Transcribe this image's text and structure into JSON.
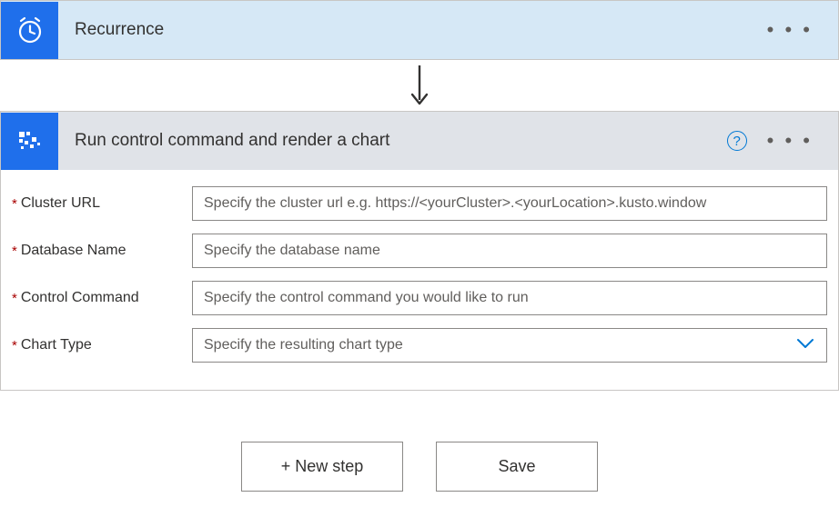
{
  "steps": {
    "recurrence": {
      "title": "Recurrence"
    },
    "kusto": {
      "title": "Run control command and render a chart",
      "fields": {
        "clusterUrl": {
          "label": "Cluster URL",
          "placeholder": "Specify the cluster url e.g. https://<yourCluster>.<yourLocation>.kusto.window"
        },
        "databaseName": {
          "label": "Database Name",
          "placeholder": "Specify the database name"
        },
        "controlCommand": {
          "label": "Control Command",
          "placeholder": "Specify the control command you would like to run"
        },
        "chartType": {
          "label": "Chart Type",
          "placeholder": "Specify the resulting chart type"
        }
      }
    }
  },
  "footer": {
    "newStep": "+ New step",
    "save": "Save"
  },
  "glyphs": {
    "help": "?",
    "required": "*",
    "dots": "• • •"
  }
}
